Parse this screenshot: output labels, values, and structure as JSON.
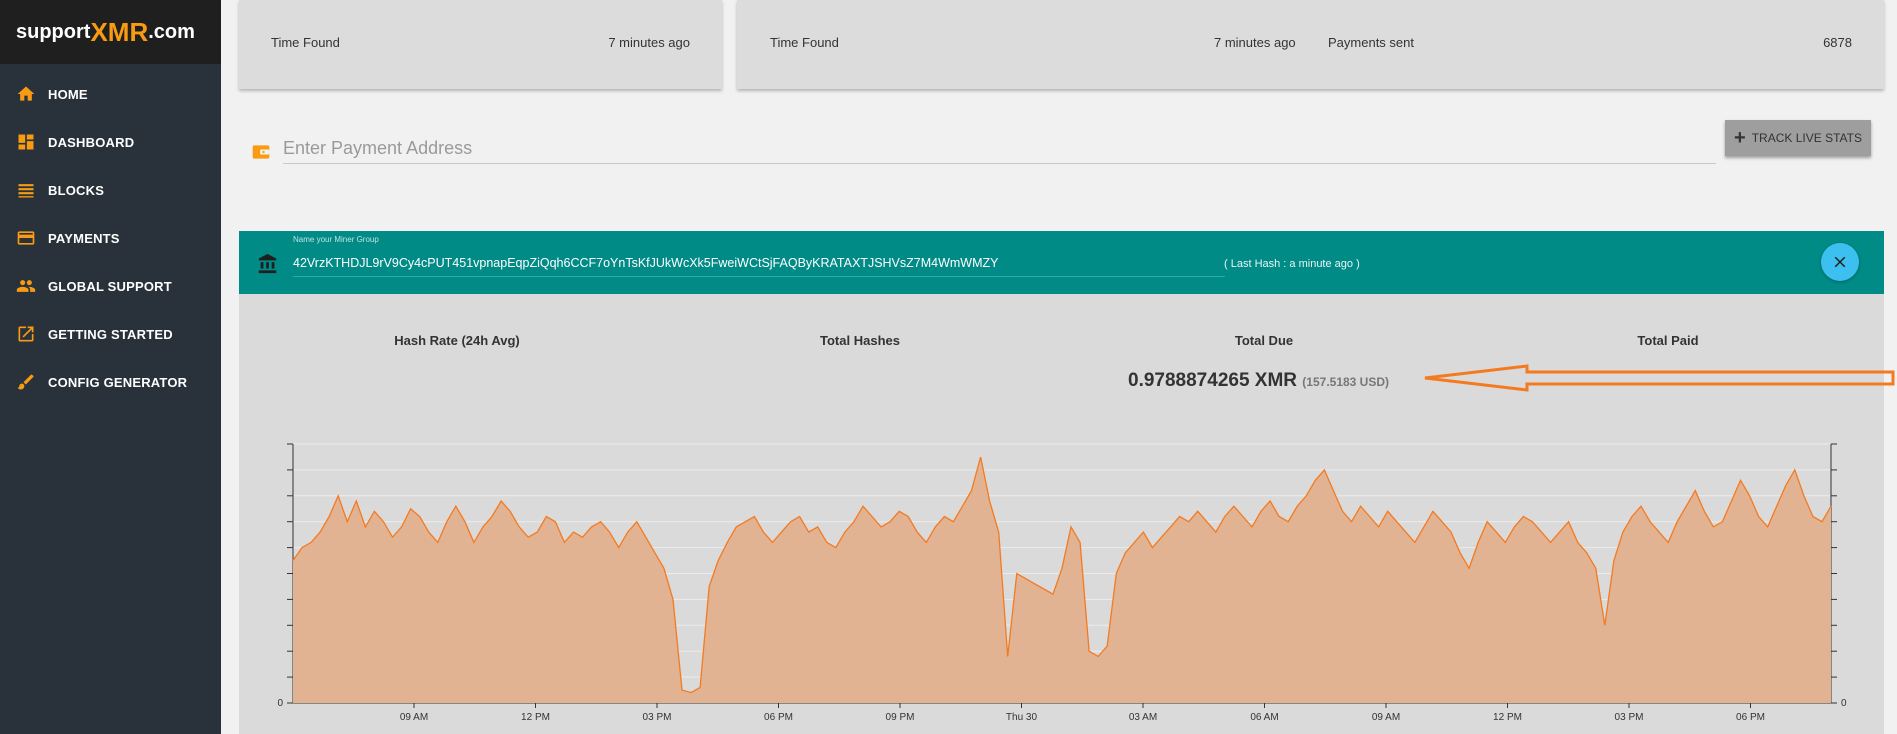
{
  "brand": {
    "part1": "support",
    "part2": "XMR",
    "part3": ".com"
  },
  "sidebar": {
    "items": [
      {
        "label": "HOME",
        "icon": "home-icon"
      },
      {
        "label": "DASHBOARD",
        "icon": "dashboard-icon"
      },
      {
        "label": "BLOCKS",
        "icon": "blocks-icon"
      },
      {
        "label": "PAYMENTS",
        "icon": "payments-icon"
      },
      {
        "label": "GLOBAL SUPPORT",
        "icon": "people-icon"
      },
      {
        "label": "GETTING STARTED",
        "icon": "external-link-icon"
      },
      {
        "label": "CONFIG GENERATOR",
        "icon": "brush-icon"
      }
    ],
    "icon_color": "#f89b12"
  },
  "cards": {
    "card1": {
      "label": "Time Found",
      "value": "7 minutes ago"
    },
    "card2": {
      "label": "Time Found",
      "value": "7 minutes ago",
      "label2": "Payments sent",
      "value2": "6878"
    }
  },
  "address": {
    "placeholder": "Enter Payment Address",
    "track_label": "TRACK LIVE STATS"
  },
  "miner": {
    "group_label": "Name your Miner Group",
    "address": "42VrzKTHDJL9rV9Cy4cPUT451vpnapEqpZiQqh6CCF7oYnTsKfJUkWcXk5FweiWCtSjFAQByKRATAXTJSHVsZ7M4WmWMZY",
    "last_hash": "( Last Hash : a minute ago )",
    "bar_color": "#008b87"
  },
  "stats": {
    "headers": [
      "Hash Rate (24h Avg)",
      "Total Hashes",
      "Total Due",
      "Total Paid"
    ],
    "total_due": "0.9788874265 XMR",
    "total_due_usd": "(157.5183 USD)"
  },
  "chart_data": {
    "type": "area",
    "x_ticks": [
      "09 AM",
      "12 PM",
      "03 PM",
      "06 PM",
      "09 PM",
      "Thu 30",
      "03 AM",
      "06 AM",
      "09 AM",
      "12 PM",
      "03 PM",
      "06 PM"
    ],
    "y_left_label": "0",
    "y_right_label": "0",
    "line_color": "#f47a1f",
    "fill_color": "#e2b392",
    "values": [
      0.55,
      0.6,
      0.62,
      0.66,
      0.72,
      0.8,
      0.7,
      0.78,
      0.68,
      0.74,
      0.7,
      0.64,
      0.68,
      0.75,
      0.72,
      0.66,
      0.62,
      0.7,
      0.76,
      0.7,
      0.62,
      0.68,
      0.72,
      0.78,
      0.74,
      0.68,
      0.64,
      0.66,
      0.72,
      0.7,
      0.62,
      0.66,
      0.64,
      0.68,
      0.7,
      0.66,
      0.6,
      0.66,
      0.7,
      0.64,
      0.58,
      0.52,
      0.4,
      0.05,
      0.04,
      0.06,
      0.45,
      0.55,
      0.62,
      0.68,
      0.7,
      0.72,
      0.66,
      0.62,
      0.66,
      0.7,
      0.72,
      0.66,
      0.68,
      0.62,
      0.6,
      0.66,
      0.7,
      0.76,
      0.72,
      0.68,
      0.7,
      0.74,
      0.72,
      0.66,
      0.62,
      0.68,
      0.72,
      0.7,
      0.76,
      0.82,
      0.95,
      0.78,
      0.66,
      0.18,
      0.5,
      0.48,
      0.46,
      0.44,
      0.42,
      0.52,
      0.68,
      0.62,
      0.2,
      0.18,
      0.22,
      0.5,
      0.58,
      0.62,
      0.66,
      0.6,
      0.64,
      0.68,
      0.72,
      0.7,
      0.74,
      0.7,
      0.66,
      0.72,
      0.76,
      0.72,
      0.68,
      0.74,
      0.78,
      0.72,
      0.7,
      0.76,
      0.8,
      0.86,
      0.9,
      0.82,
      0.74,
      0.7,
      0.76,
      0.72,
      0.68,
      0.74,
      0.7,
      0.66,
      0.62,
      0.68,
      0.74,
      0.7,
      0.66,
      0.58,
      0.52,
      0.62,
      0.7,
      0.66,
      0.62,
      0.68,
      0.72,
      0.7,
      0.66,
      0.62,
      0.66,
      0.7,
      0.62,
      0.58,
      0.52,
      0.3,
      0.55,
      0.66,
      0.72,
      0.76,
      0.7,
      0.66,
      0.62,
      0.7,
      0.76,
      0.82,
      0.74,
      0.68,
      0.7,
      0.78,
      0.86,
      0.8,
      0.72,
      0.68,
      0.76,
      0.84,
      0.9,
      0.8,
      0.72,
      0.7,
      0.76
    ],
    "ylim": [
      0,
      1
    ]
  }
}
